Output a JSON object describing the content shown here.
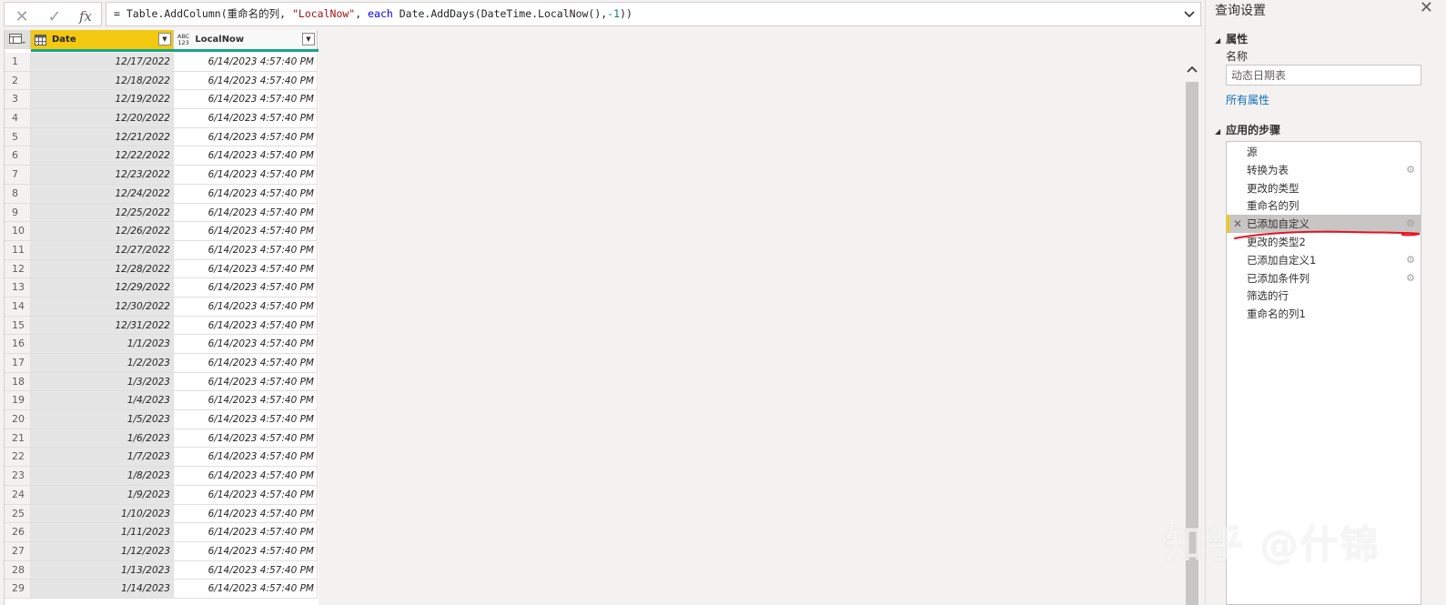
{
  "formula_bar": {
    "cancel_icon": "x-icon",
    "commit_icon": "check-icon",
    "fx_label": "fx",
    "formula_parts": {
      "prefix": "= Table.AddColumn(重命名的列, ",
      "string_arg": "\"LocalNow\"",
      "sep": ", ",
      "keyword": "each",
      "body": " Date.AddDays(DateTime.LocalNow(),",
      "number": "-1",
      "suffix": "))"
    }
  },
  "grid": {
    "columns": [
      {
        "name": "Date",
        "type_icon": "calendar-icon"
      },
      {
        "name": "LocalNow",
        "type_icon": "any-type-icon",
        "type_label_top": "ABC",
        "type_label_bottom": "123"
      }
    ],
    "rows": [
      {
        "n": "1",
        "date": "12/17/2022",
        "local": "6/14/2023 4:57:40 PM"
      },
      {
        "n": "2",
        "date": "12/18/2022",
        "local": "6/14/2023 4:57:40 PM"
      },
      {
        "n": "3",
        "date": "12/19/2022",
        "local": "6/14/2023 4:57:40 PM"
      },
      {
        "n": "4",
        "date": "12/20/2022",
        "local": "6/14/2023 4:57:40 PM"
      },
      {
        "n": "5",
        "date": "12/21/2022",
        "local": "6/14/2023 4:57:40 PM"
      },
      {
        "n": "6",
        "date": "12/22/2022",
        "local": "6/14/2023 4:57:40 PM"
      },
      {
        "n": "7",
        "date": "12/23/2022",
        "local": "6/14/2023 4:57:40 PM"
      },
      {
        "n": "8",
        "date": "12/24/2022",
        "local": "6/14/2023 4:57:40 PM"
      },
      {
        "n": "9",
        "date": "12/25/2022",
        "local": "6/14/2023 4:57:40 PM"
      },
      {
        "n": "10",
        "date": "12/26/2022",
        "local": "6/14/2023 4:57:40 PM"
      },
      {
        "n": "11",
        "date": "12/27/2022",
        "local": "6/14/2023 4:57:40 PM"
      },
      {
        "n": "12",
        "date": "12/28/2022",
        "local": "6/14/2023 4:57:40 PM"
      },
      {
        "n": "13",
        "date": "12/29/2022",
        "local": "6/14/2023 4:57:40 PM"
      },
      {
        "n": "14",
        "date": "12/30/2022",
        "local": "6/14/2023 4:57:40 PM"
      },
      {
        "n": "15",
        "date": "12/31/2022",
        "local": "6/14/2023 4:57:40 PM"
      },
      {
        "n": "16",
        "date": "1/1/2023",
        "local": "6/14/2023 4:57:40 PM"
      },
      {
        "n": "17",
        "date": "1/2/2023",
        "local": "6/14/2023 4:57:40 PM"
      },
      {
        "n": "18",
        "date": "1/3/2023",
        "local": "6/14/2023 4:57:40 PM"
      },
      {
        "n": "19",
        "date": "1/4/2023",
        "local": "6/14/2023 4:57:40 PM"
      },
      {
        "n": "20",
        "date": "1/5/2023",
        "local": "6/14/2023 4:57:40 PM"
      },
      {
        "n": "21",
        "date": "1/6/2023",
        "local": "6/14/2023 4:57:40 PM"
      },
      {
        "n": "22",
        "date": "1/7/2023",
        "local": "6/14/2023 4:57:40 PM"
      },
      {
        "n": "23",
        "date": "1/8/2023",
        "local": "6/14/2023 4:57:40 PM"
      },
      {
        "n": "24",
        "date": "1/9/2023",
        "local": "6/14/2023 4:57:40 PM"
      },
      {
        "n": "25",
        "date": "1/10/2023",
        "local": "6/14/2023 4:57:40 PM"
      },
      {
        "n": "26",
        "date": "1/11/2023",
        "local": "6/14/2023 4:57:40 PM"
      },
      {
        "n": "27",
        "date": "1/12/2023",
        "local": "6/14/2023 4:57:40 PM"
      },
      {
        "n": "28",
        "date": "1/13/2023",
        "local": "6/14/2023 4:57:40 PM"
      },
      {
        "n": "29",
        "date": "1/14/2023",
        "local": "6/14/2023 4:57:40 PM"
      }
    ]
  },
  "query_settings": {
    "title": "查询设置",
    "properties_heading": "属性",
    "name_label": "名称",
    "name_value": "动态日期表",
    "all_properties_link": "所有属性",
    "applied_steps_heading": "应用的步骤",
    "steps": [
      {
        "label": "源",
        "gear": false,
        "selected": false
      },
      {
        "label": "转换为表",
        "gear": true,
        "selected": false
      },
      {
        "label": "更改的类型",
        "gear": false,
        "selected": false
      },
      {
        "label": "重命名的列",
        "gear": false,
        "selected": false
      },
      {
        "label": "已添加自定义",
        "gear": true,
        "selected": true
      },
      {
        "label": "更改的类型2",
        "gear": false,
        "selected": false
      },
      {
        "label": "已添加自定义1",
        "gear": true,
        "selected": false
      },
      {
        "label": "已添加条件列",
        "gear": true,
        "selected": false
      },
      {
        "label": "筛选的行",
        "gear": false,
        "selected": false
      },
      {
        "label": "重命名的列1",
        "gear": false,
        "selected": false
      }
    ]
  },
  "watermark": "知乎 @什锦",
  "colors": {
    "accent_yellow": "#f2c811",
    "quality_green": "#17a589",
    "link_blue": "#106ebe",
    "annotation_red": "#e81123"
  }
}
